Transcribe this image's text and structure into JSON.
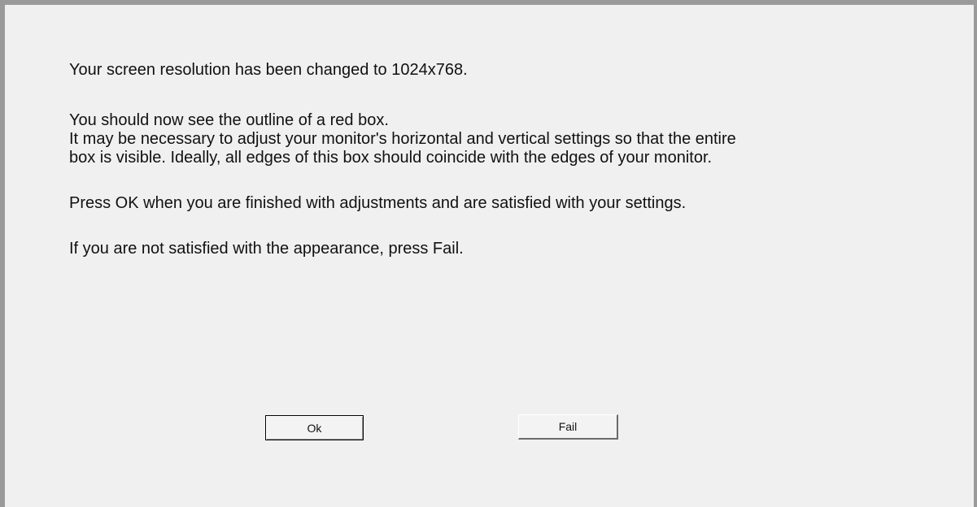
{
  "dialog": {
    "line1": "Your screen resolution has been changed to 1024x768.",
    "line2": "You should now see the outline of a red box.",
    "line3": "It may be necessary to adjust your monitor's horizontal and vertical  settings so that the entire",
    "line4": "box is visible.  Ideally, all edges of this box should coincide with the edges of your monitor.",
    "line5": "Press OK when you are finished with adjustments and are satisfied with your settings.",
    "line6": "If you are not satisfied with the appearance, press Fail."
  },
  "buttons": {
    "ok_label": "Ok",
    "fail_label": "Fail"
  },
  "colors": {
    "background": "#f0f0f0",
    "frame": "#9a9a9a",
    "text": "#111111"
  }
}
